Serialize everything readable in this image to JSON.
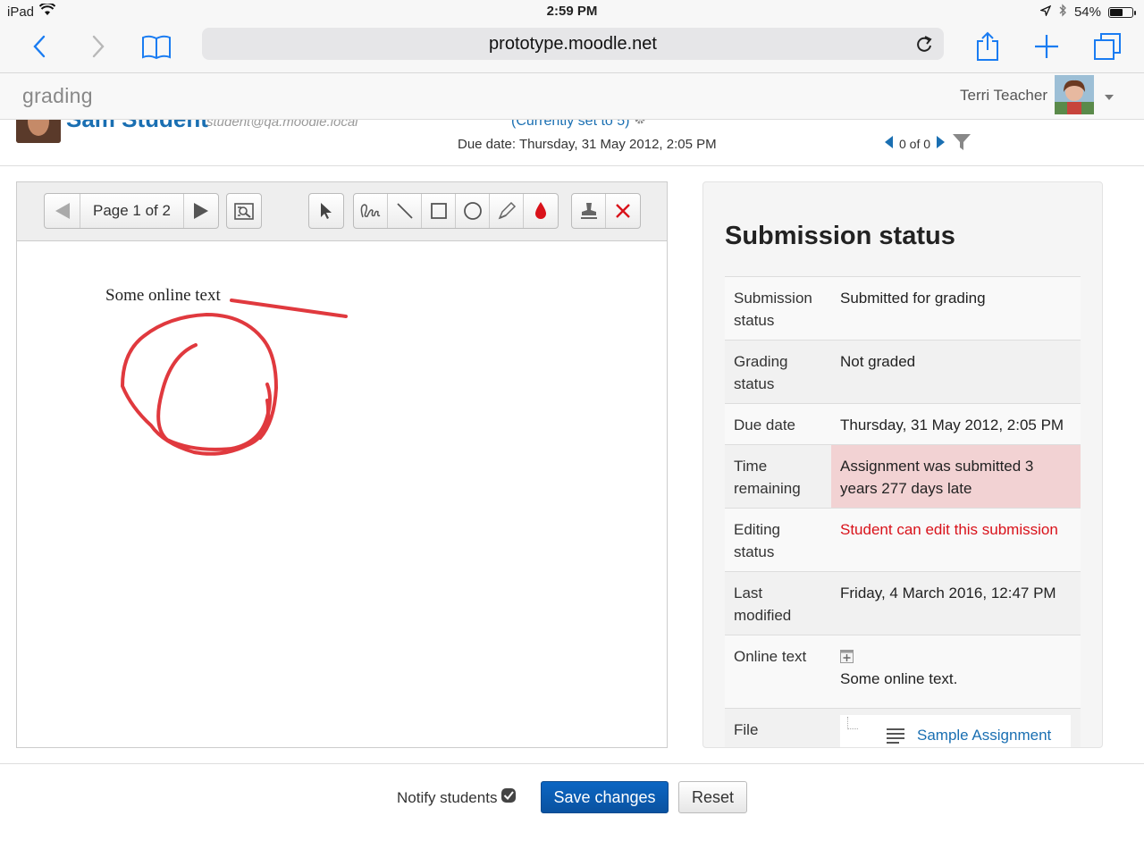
{
  "status_bar": {
    "device": "iPad",
    "time": "2:59 PM",
    "battery": "54%",
    "battery_level": 0.54
  },
  "browser": {
    "url": "prototype.moodle.net"
  },
  "moodle_header": {
    "brand": "grading",
    "user_name": "Terri Teacher"
  },
  "info_strip": {
    "student_name": "Sam Student",
    "student_email": "student@qa.moodle.local",
    "currently_set": "(Currently set to 5)",
    "due_date_line": "Due date: Thursday, 31 May 2012, 2:05 PM",
    "pager_label": "0 of 0"
  },
  "editor": {
    "page_label": "Page 1 of 2",
    "pdf_text": "Some online text",
    "colors": {
      "annotation": "#e0393e",
      "tool_red": "#d9121a"
    }
  },
  "submission_status": {
    "title": "Submission status",
    "rows": [
      {
        "label": "Submission status",
        "value": "Submitted for grading"
      },
      {
        "label": "Grading status",
        "value": "Not graded"
      },
      {
        "label": "Due date",
        "value": "Thursday, 31 May 2012, 2:05 PM"
      },
      {
        "label": "Time remaining",
        "value": "Assignment was submitted 3 years 277 days late"
      },
      {
        "label": "Editing status",
        "value": "Student can edit this submission"
      },
      {
        "label": "Last modified",
        "value": "Friday, 4 March 2016, 12:47 PM"
      },
      {
        "label": "Online text",
        "value": "Some online text."
      },
      {
        "label": "File",
        "value": "Sample Assignment"
      }
    ]
  },
  "bottom": {
    "notify_label": "Notify students",
    "notify_checked": true,
    "save_label": "Save changes",
    "reset_label": "Reset"
  }
}
